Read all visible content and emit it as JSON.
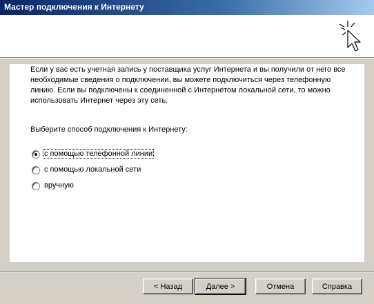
{
  "window": {
    "title": "Мастер подключения к Интернету"
  },
  "content": {
    "intro": "Если у вас есть учетная запись у поставщика услуг Интернета и вы получили от него все необходимые сведения о подключении, вы можете подключиться через телефонную линию. Если вы подключены к соединенной с Интернетом локальной сети, то можно использовать Интернет через эту сеть.",
    "prompt": "Выберите способ подключения к Интернету:",
    "options": [
      {
        "label": "с помощью телефонной линии",
        "selected": true
      },
      {
        "label": "с помощью локальной сети",
        "selected": false
      },
      {
        "label": "вручную",
        "selected": false
      }
    ]
  },
  "buttons": {
    "back": "< Назад",
    "next": "Далее >",
    "cancel": "Отмена",
    "help": "Справка"
  },
  "icons": {
    "header": "wizard-sparkle-cursor-icon"
  },
  "colors": {
    "titlebar_start": "#0a246a",
    "titlebar_end": "#a6caf0",
    "face": "#d4d0c8"
  }
}
